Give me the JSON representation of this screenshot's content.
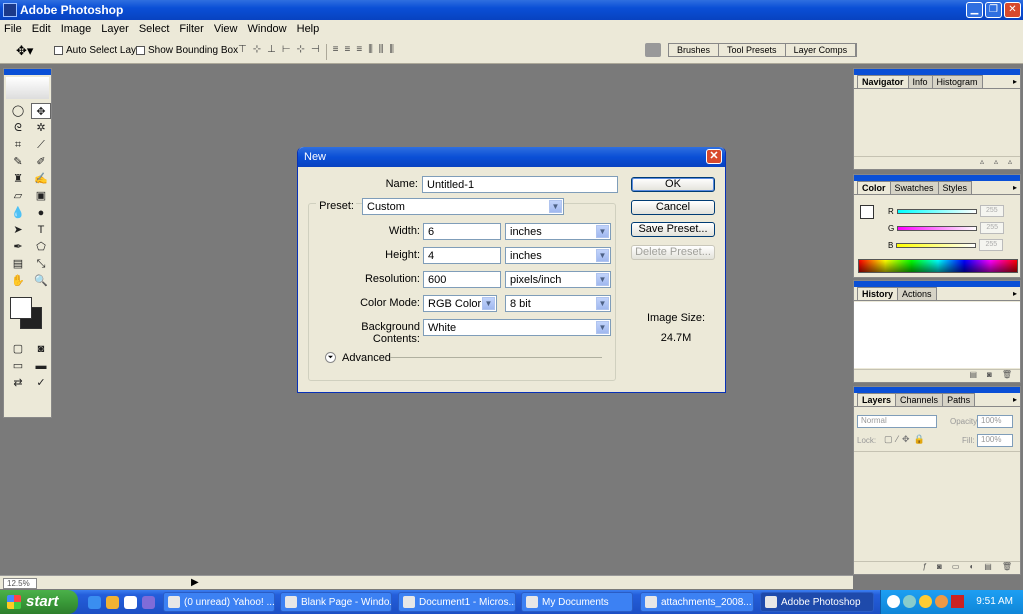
{
  "window": {
    "title": "Adobe Photoshop"
  },
  "menu": [
    "File",
    "Edit",
    "Image",
    "Layer",
    "Select",
    "Filter",
    "View",
    "Window",
    "Help"
  ],
  "options_bar": {
    "auto_select": "Auto Select Layer",
    "bounding_box": "Show Bounding Box",
    "palette_well": [
      "Brushes",
      "Tool Presets",
      "Layer Comps"
    ]
  },
  "dialog": {
    "title": "New",
    "name_label": "Name:",
    "name_value": "Untitled-1",
    "preset_label": "Preset:",
    "preset_value": "Custom",
    "width_label": "Width:",
    "width_value": "6",
    "width_unit": "inches",
    "height_label": "Height:",
    "height_value": "4",
    "height_unit": "inches",
    "resolution_label": "Resolution:",
    "resolution_value": "600",
    "resolution_unit": "pixels/inch",
    "color_mode_label": "Color Mode:",
    "color_mode_value": "RGB Color",
    "bit_depth": "8 bit",
    "bg_label": "Background Contents:",
    "bg_value": "White",
    "advanced": "Advanced",
    "ok": "OK",
    "cancel": "Cancel",
    "save_preset": "Save Preset...",
    "delete_preset": "Delete Preset...",
    "image_size_label": "Image Size:",
    "image_size_value": "24.7M"
  },
  "panels": {
    "navigator_tabs": [
      "Navigator",
      "Info",
      "Histogram"
    ],
    "color_tabs": [
      "Color",
      "Swatches",
      "Styles"
    ],
    "color_channels": [
      {
        "label": "R",
        "value": "255"
      },
      {
        "label": "G",
        "value": "255"
      },
      {
        "label": "B",
        "value": "255"
      }
    ],
    "history_tabs": [
      "History",
      "Actions"
    ],
    "layers_tabs": [
      "Layers",
      "Channels",
      "Paths"
    ],
    "blend_mode": "Normal",
    "opacity_label": "Opacity:",
    "opacity_value": "100%",
    "lock_label": "Lock:",
    "fill_label": "Fill:",
    "fill_value": "100%"
  },
  "status": {
    "zoom": "12.5%"
  },
  "taskbar": {
    "start": "start",
    "buttons": [
      "(0 unread) Yahoo! ...",
      "Blank Page - Windo...",
      "Document1 - Micros...",
      "My Documents",
      "attachments_2008...",
      "Adobe Photoshop"
    ],
    "clock": "9:51 AM"
  }
}
